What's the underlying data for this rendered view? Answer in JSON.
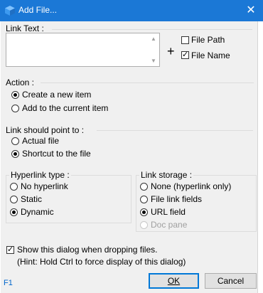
{
  "window": {
    "title": "Add File...",
    "close_glyph": "✕",
    "icon": "app-cube-icon",
    "accent_color": "#1b78d6"
  },
  "link_text": {
    "label": "Link Text :",
    "value": "",
    "plus": "+",
    "file_path_label": "File Path",
    "file_path_checked": false,
    "file_name_label": "File Name",
    "file_name_checked": true
  },
  "action": {
    "label": "Action :",
    "options": [
      {
        "label": "Create a new item",
        "selected": true
      },
      {
        "label": "Add to the current item",
        "selected": false
      }
    ]
  },
  "point_to": {
    "label": "Link should point to :",
    "options": [
      {
        "label": "Actual file",
        "selected": false
      },
      {
        "label": "Shortcut to the file",
        "selected": true
      }
    ]
  },
  "hyperlink_type": {
    "label": "Hyperlink type :",
    "options": [
      {
        "label": "No hyperlink",
        "selected": false
      },
      {
        "label": "Static",
        "selected": false
      },
      {
        "label": "Dynamic",
        "selected": true
      }
    ]
  },
  "link_storage": {
    "label": "Link storage :",
    "options": [
      {
        "label": "None (hyperlink only)",
        "selected": false,
        "enabled": true
      },
      {
        "label": "File link fields",
        "selected": false,
        "enabled": true
      },
      {
        "label": "URL field",
        "selected": true,
        "enabled": true
      },
      {
        "label": "Doc pane",
        "selected": false,
        "enabled": false
      }
    ]
  },
  "show_dialog": {
    "label": "Show this dialog when dropping files.",
    "checked": true,
    "hint": "(Hint: Hold Ctrl to force display of this dialog)"
  },
  "buttons": {
    "ok": "OK",
    "cancel": "Cancel",
    "f1": "F1"
  }
}
